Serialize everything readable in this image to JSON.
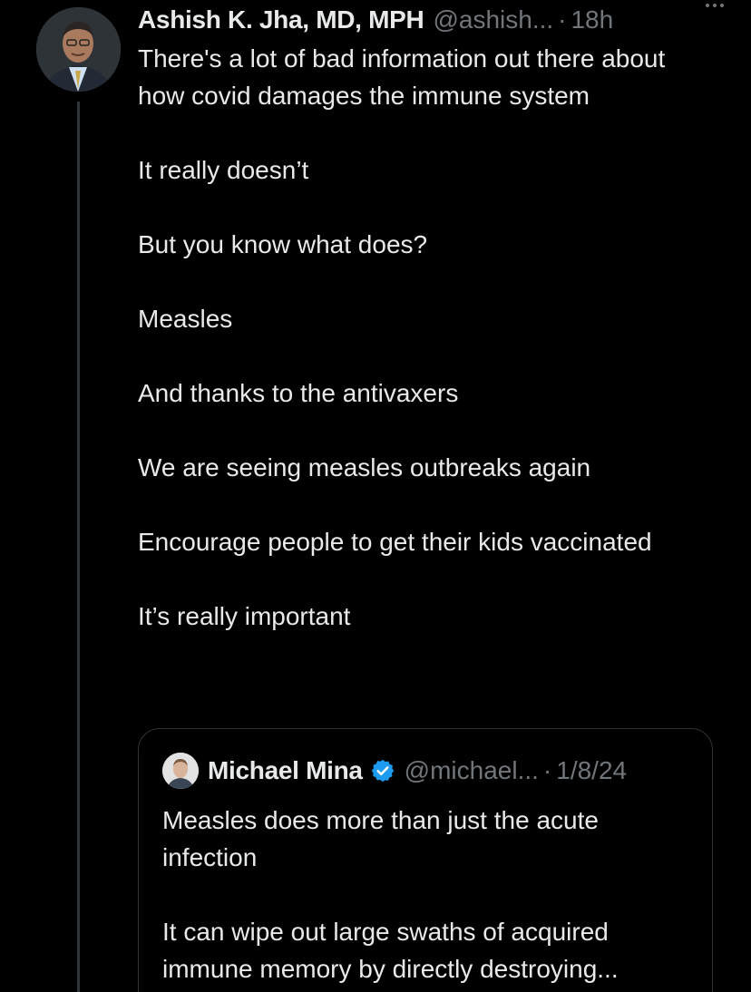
{
  "tweet": {
    "author": {
      "display_name": "Ashish K. Jha, MD, MPH",
      "handle": "@ashish...",
      "separator": "·",
      "time": "18h"
    },
    "more_icon": "more-horizontal-icon",
    "paragraphs": [
      "There's a lot of bad information out there about how covid damages the immune system",
      "It really doesn’t",
      "But you know what does?",
      "Measles",
      "And thanks to the antivaxers",
      "We are seeing measles outbreaks again",
      "Encourage people to get their kids vaccinated",
      "It’s really important"
    ]
  },
  "quote": {
    "author": {
      "display_name": "Michael Mina",
      "verified_icon": "verified-badge-icon",
      "handle": "@michael...",
      "separator": "·",
      "date": "1/8/24"
    },
    "paragraphs": [
      "Measles does more than just the acute infection",
      "It can wipe out large swaths of acquired immune memory by directly destroying..."
    ]
  },
  "colors": {
    "background": "#000000",
    "text": "#e7e9ea",
    "muted": "#71767b",
    "border": "#2f3336",
    "verified": "#1d9bf0"
  }
}
